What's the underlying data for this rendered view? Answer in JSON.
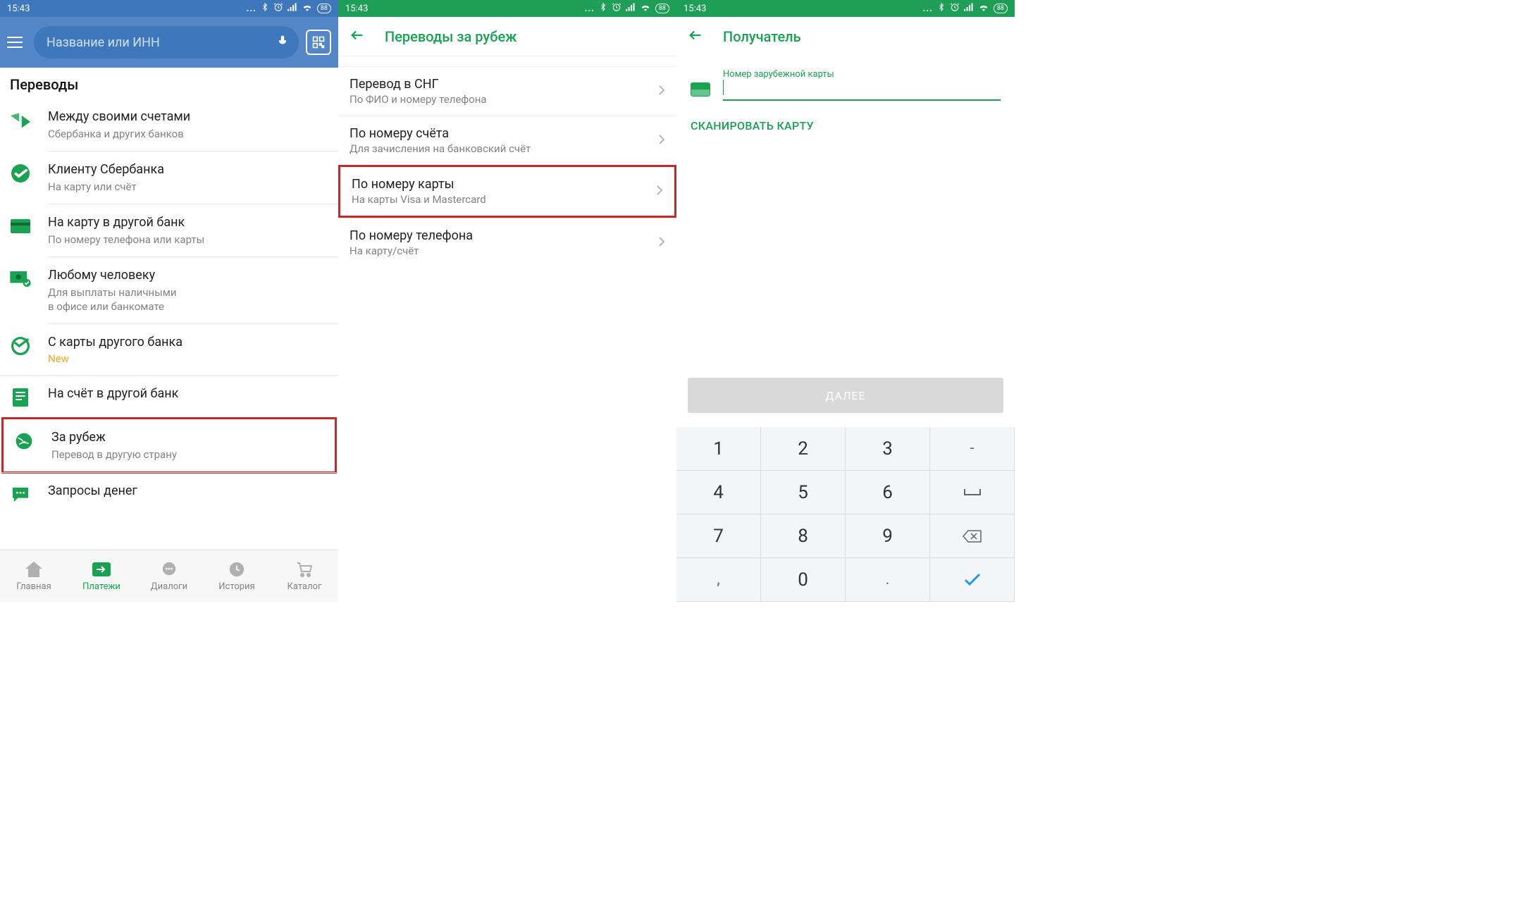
{
  "status": {
    "time": "15:43",
    "battery": "88"
  },
  "screen1": {
    "search_placeholder": "Название или ИНН",
    "section_title": "Переводы",
    "items": [
      {
        "title": "Между своими счетами",
        "subtitle": "Сбербанка и других банков"
      },
      {
        "title": "Клиенту Сбербанка",
        "subtitle": "На карту или счёт"
      },
      {
        "title": "На карту в другой банк",
        "subtitle": "По номеру телефона или карты"
      },
      {
        "title": "Любому человеку",
        "subtitle": "Для выплаты наличными\nв офисе или банкомате"
      },
      {
        "title": "С карты другого банка",
        "new": "New"
      },
      {
        "title": "На счёт в другой банк"
      },
      {
        "title": "За рубеж",
        "subtitle": "Перевод в другую страну"
      },
      {
        "title": "Запросы денег"
      }
    ],
    "nav": [
      {
        "label": "Главная"
      },
      {
        "label": "Платежи"
      },
      {
        "label": "Диалоги"
      },
      {
        "label": "История"
      },
      {
        "label": "Каталог"
      }
    ]
  },
  "screen2": {
    "title": "Переводы за рубеж",
    "items": [
      {
        "title": "Перевод в СНГ",
        "subtitle": "По ФИО и номеру телефона"
      },
      {
        "title": "По номеру счёта",
        "subtitle": "Для зачисления на банковский счёт"
      },
      {
        "title": "По номеру карты",
        "subtitle": "На карты Visa и Mastercard"
      },
      {
        "title": "По номеру телефона",
        "subtitle": "На карту/счёт"
      }
    ]
  },
  "screen3": {
    "title": "Получатель",
    "field_label": "Номер зарубежной карты",
    "scan_label": "СКАНИРОВАТЬ КАРТУ",
    "next_label": "ДАЛЕЕ",
    "keys": [
      "1",
      "2",
      "3",
      "-",
      "4",
      "5",
      "6",
      "␣",
      "7",
      "8",
      "9",
      "⌫",
      ",",
      "0",
      ".",
      "✓"
    ]
  }
}
